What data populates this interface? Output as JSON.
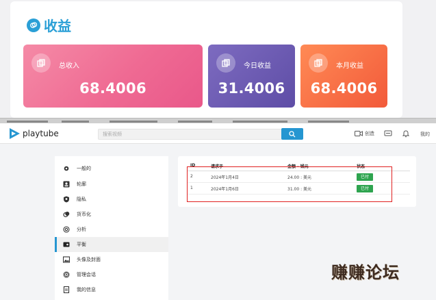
{
  "earnings": {
    "title": "收益",
    "cards": [
      {
        "label": "总收入",
        "value": "68.4006",
        "color": "#ef6a93"
      },
      {
        "label": "今日收益",
        "value": "31.4006",
        "color": "#5e4da6"
      },
      {
        "label": "本月收益",
        "value": "68.4006",
        "color": "#f25a3a"
      }
    ],
    "accent": "#2a9fd6"
  },
  "playtube": {
    "logo_text": "playtube",
    "search_placeholder": "搜索视频",
    "upload_label": "创造",
    "more_label": "我的",
    "sidebar": [
      {
        "label": "一般的",
        "icon": "gear-icon"
      },
      {
        "label": "轮廓",
        "icon": "profile-icon"
      },
      {
        "label": "隐私",
        "icon": "shield-icon"
      },
      {
        "label": "货币化",
        "icon": "coins-icon"
      },
      {
        "label": "分析",
        "icon": "at-icon"
      },
      {
        "label": "平衡",
        "icon": "wallet-icon",
        "active": true
      },
      {
        "label": "头像及封面",
        "icon": "image-icon"
      },
      {
        "label": "管理会话",
        "icon": "fingerprint-icon"
      },
      {
        "label": "我的信息",
        "icon": "document-icon"
      }
    ],
    "table": {
      "headers": [
        "ID",
        "请求于",
        "金额 - 钱元",
        "状态"
      ],
      "rows": [
        {
          "id": "2",
          "date": "2024年1月4日",
          "amount": "24.00 : 美元",
          "status": "已付"
        },
        {
          "id": "1",
          "date": "2024年1月6日",
          "amount": "31.00 : 美元",
          "status": "已付"
        }
      ]
    },
    "primary_color": "#2596d1"
  },
  "watermark": "赚赚论坛"
}
